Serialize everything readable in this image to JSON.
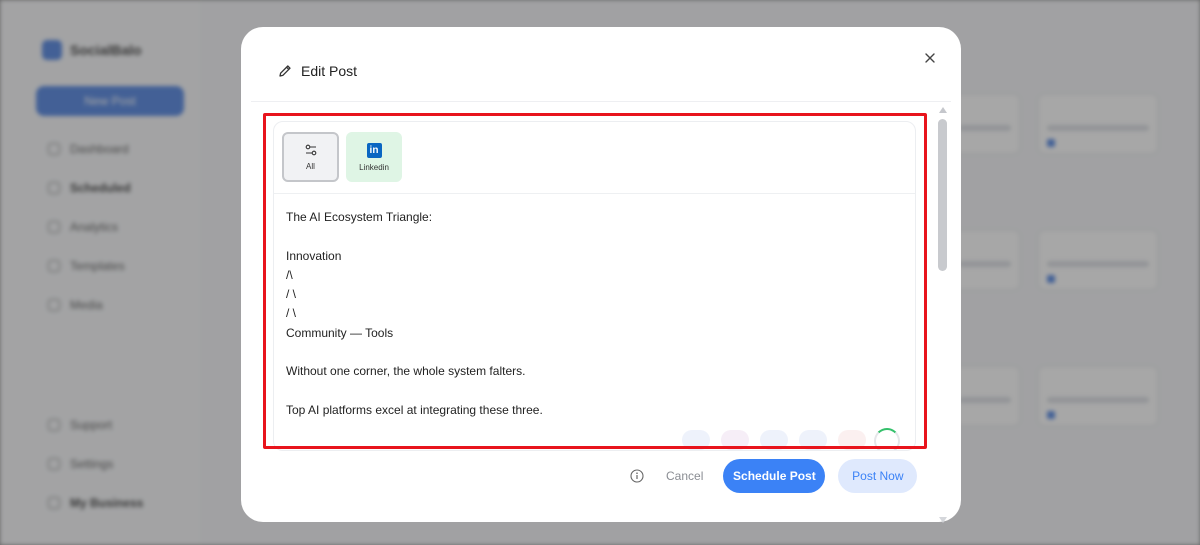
{
  "modal": {
    "title": "Edit Post",
    "close_label": "×"
  },
  "platforms": [
    {
      "label": "All",
      "selected": true
    },
    {
      "label": "Linkedin",
      "selected": false
    }
  ],
  "linkedin_glyph": "in",
  "post": {
    "lines": [
      "The AI Ecosystem Triangle:",
      "",
      "Innovation",
      "/\\",
      "/ \\",
      "/ \\",
      "Community — Tools",
      "",
      "Without one corner, the whole system falters.",
      "",
      "Top AI platforms excel at integrating these three."
    ]
  },
  "footer": {
    "cancel_label": "Cancel",
    "schedule_label": "Schedule Post",
    "post_now_label": "Post Now"
  },
  "colors": {
    "primary": "#3b82f6",
    "highlight": "#e8141c",
    "linkedin": "#0a66c2",
    "linkedin_tab_bg": "#dff5e5"
  },
  "background": {
    "brand": "SocialBalo",
    "new_post": "New Post",
    "nav": [
      "Dashboard",
      "Scheduled",
      "Analytics",
      "Templates",
      "Media"
    ],
    "bottom_nav": [
      "Support",
      "Settings",
      "My Business"
    ]
  }
}
